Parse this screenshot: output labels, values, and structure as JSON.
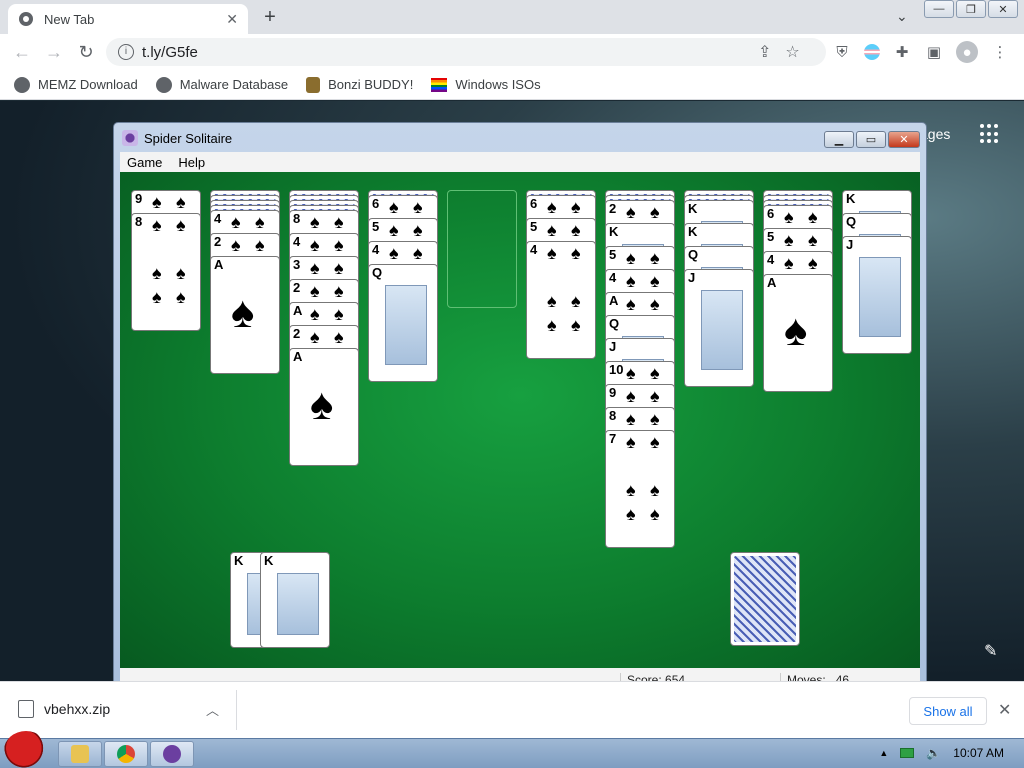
{
  "browser": {
    "tab_title": "New Tab",
    "tab_close": "✕",
    "new_tab": "+",
    "url": "t.ly/G5fe",
    "window_minimize": "—",
    "window_restore": "❐",
    "window_close": "✕"
  },
  "bookmarks": [
    {
      "label": "MEMZ Download",
      "icon": "globe-icon"
    },
    {
      "label": "Malware Database",
      "icon": "globe-icon"
    },
    {
      "label": "Bonzi BUDDY!",
      "icon": "bonzi-icon"
    },
    {
      "label": "Windows ISOs",
      "icon": "rainbow-flag-icon"
    }
  ],
  "page": {
    "images_link_partial": "ages"
  },
  "solitaire": {
    "title": "Spider Solitaire",
    "menu": [
      "Game",
      "Help"
    ],
    "score_label": "Score:",
    "score_value": "654",
    "moves_label": "Moves:",
    "moves_value": "46",
    "columns": [
      {
        "face_down": 0,
        "face_up": [
          "9",
          "8"
        ]
      },
      {
        "face_down": 4,
        "face_up": [
          "4",
          "2",
          "A"
        ]
      },
      {
        "face_down": 4,
        "face_up": [
          "8",
          "4",
          "3",
          "2",
          "A",
          "2",
          "A"
        ]
      },
      {
        "face_down": 1,
        "face_up": [
          "6",
          "5",
          "4",
          "Q"
        ]
      },
      {
        "face_down": 0,
        "face_up": []
      },
      {
        "face_down": 1,
        "face_up": [
          "6",
          "5",
          "4"
        ]
      },
      {
        "face_down": 2,
        "face_up": [
          "2",
          "K",
          "5",
          "4",
          "A",
          "Q",
          "J",
          "10",
          "9",
          "8",
          "7"
        ]
      },
      {
        "face_down": 2,
        "face_up": [
          "K",
          "K",
          "Q",
          "J"
        ]
      },
      {
        "face_down": 3,
        "face_up": [
          "6",
          "5",
          "4",
          "A"
        ]
      },
      {
        "face_down": 0,
        "face_up": [
          "K",
          "Q",
          "J"
        ]
      }
    ],
    "completed": [
      "K",
      "K"
    ]
  },
  "downloads": {
    "file": "vbehxx.zip",
    "show_all": "Show all",
    "close": "✕"
  },
  "taskbar": {
    "time": "10:07 AM"
  }
}
